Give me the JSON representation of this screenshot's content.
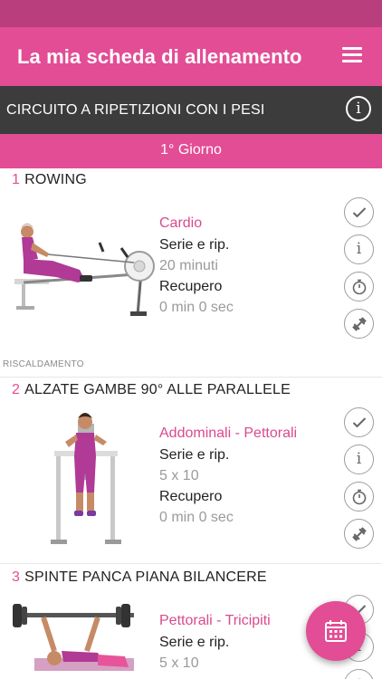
{
  "app": {
    "title": "La mia scheda di allenamento"
  },
  "program": {
    "title": "CIRCUITO A RIPETIZIONI CON I PESI"
  },
  "day": {
    "label": "1° Giorno"
  },
  "section": {
    "label": "RISCALDAMENTO"
  },
  "labels": {
    "sets_reps": "Serie e rip.",
    "rest": "Recupero"
  },
  "exercises": [
    {
      "number": "1",
      "name": "ROWING",
      "category": "Cardio",
      "sets_reps": "20 minuti",
      "rest": "0 min 0 sec"
    },
    {
      "number": "2",
      "name": "ALZATE GAMBE 90° ALLE PARALLELE",
      "category": "Addominali - Pettorali",
      "sets_reps": "5 x 10",
      "rest": "0 min 0 sec"
    },
    {
      "number": "3",
      "name": "SPINTE PANCA PIANA BILANCERE",
      "category": "Pettorali - Tricipiti",
      "sets_reps": "5 x 10",
      "rest": ""
    }
  ],
  "icons": {
    "menu": "hamburger-menu-icon",
    "info": "info-icon",
    "check": "check-icon",
    "timer": "stopwatch-icon",
    "weights": "dumbbell-icon",
    "calendar": "calendar-icon"
  },
  "colors": {
    "primary": "#e34d95",
    "status_bar": "#b83e7d",
    "dark_bar": "#3c3c3c"
  }
}
